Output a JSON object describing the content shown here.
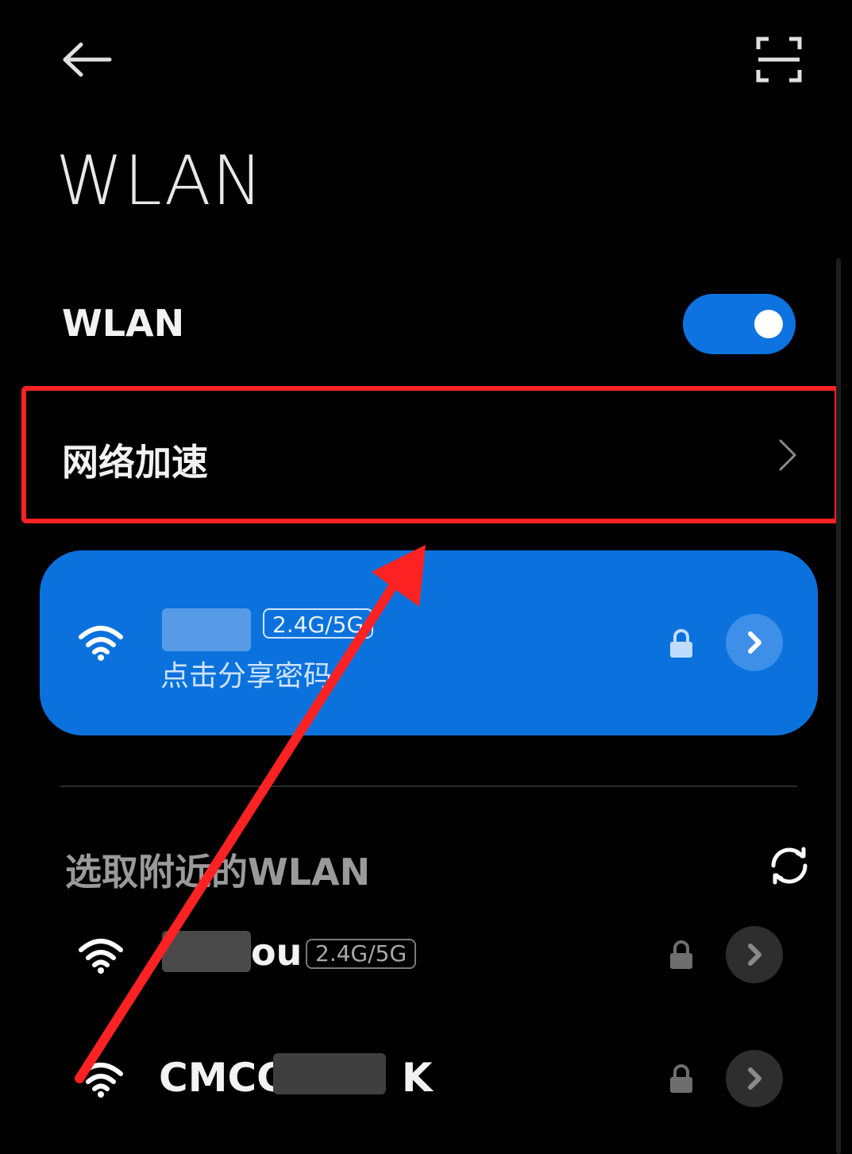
{
  "header": {
    "back_icon": "arrow-left-icon",
    "scan_icon": "scan-qr-icon",
    "title": "WLAN"
  },
  "wlan_toggle": {
    "label": "WLAN",
    "state": "on",
    "accent_color": "#0c73e0"
  },
  "network_acceleration": {
    "label": "网络加速",
    "chevron_icon": "chevron-right-icon"
  },
  "connected_network": {
    "name": "",
    "band": "2.4G/5G",
    "subtitle": "点击分享密码",
    "signal_icon": "wifi-signal-icon",
    "lock_icon": "lock-icon",
    "details_icon": "chevron-right-icon",
    "card_color": "#0b72dd"
  },
  "nearby": {
    "header": "选取附近的WLAN",
    "refresh_icon": "refresh-icon",
    "networks": [
      {
        "name": "ou",
        "band": "2.4G/5G",
        "secured": true
      },
      {
        "name": "CMCC",
        "suffix": "K",
        "secured": true
      }
    ]
  },
  "annotation": {
    "highlight_color": "#ff2222",
    "arrow_color": "#ff2222"
  }
}
